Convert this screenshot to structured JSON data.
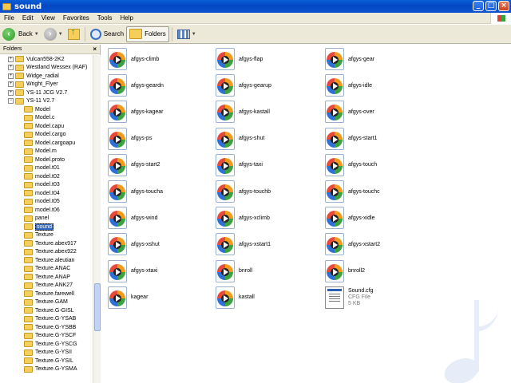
{
  "window": {
    "title": "sound",
    "buttons": [
      "_",
      "□",
      "×"
    ]
  },
  "menu": [
    "File",
    "Edit",
    "View",
    "Favorites",
    "Tools",
    "Help"
  ],
  "toolbar": {
    "back": "Back",
    "search": "Search",
    "folders": "Folders"
  },
  "folders_pane": {
    "title": "Folders",
    "close": "×",
    "tree": [
      {
        "label": "Vulcan558-2K2",
        "expander": "+"
      },
      {
        "label": "Westland Wessex (RAF)",
        "expander": "+"
      },
      {
        "label": "Widge_radial",
        "expander": "+"
      },
      {
        "label": "Wright_Flyer",
        "expander": "+"
      },
      {
        "label": "YS-11 JCG V2.7",
        "expander": "+"
      },
      {
        "label": "YS-11 V2.7",
        "expander": "−"
      },
      {
        "label": "Model"
      },
      {
        "label": "Model.c"
      },
      {
        "label": "Model.capu"
      },
      {
        "label": "Model.cargo"
      },
      {
        "label": "Model.cargoapu"
      },
      {
        "label": "Model.m"
      },
      {
        "label": "Model.proto"
      },
      {
        "label": "model.t01"
      },
      {
        "label": "model.t02"
      },
      {
        "label": "model.t03"
      },
      {
        "label": "model.t04"
      },
      {
        "label": "model.t05"
      },
      {
        "label": "model.t06"
      },
      {
        "label": "panel"
      },
      {
        "label": "sound",
        "selected": true
      },
      {
        "label": "Texture"
      },
      {
        "label": "Texture.abex917"
      },
      {
        "label": "Texture.abex922"
      },
      {
        "label": "Texture.aleutian"
      },
      {
        "label": "Texture.ANAC"
      },
      {
        "label": "Texture.ANAP"
      },
      {
        "label": "Texture.ANK27"
      },
      {
        "label": "Texture.farewell"
      },
      {
        "label": "Texture.GAM"
      },
      {
        "label": "Texture.G-GISL"
      },
      {
        "label": "Texture.G-YSAB"
      },
      {
        "label": "Texture.G-YSBB"
      },
      {
        "label": "Texture.G-YSCF"
      },
      {
        "label": "Texture.G-YSCG"
      },
      {
        "label": "Texture.G-YSII"
      },
      {
        "label": "Texture.G-YSIL"
      },
      {
        "label": "Texture.G-YSMA"
      }
    ]
  },
  "files": [
    {
      "name": "afgys-climb"
    },
    {
      "name": "afgys-flap"
    },
    {
      "name": "afgys-gear"
    },
    {
      "name": "afgys-geardn"
    },
    {
      "name": "afgys-gearup"
    },
    {
      "name": "afgys-idle"
    },
    {
      "name": "afgys-kagear"
    },
    {
      "name": "afgys-kastall"
    },
    {
      "name": "afgys-over"
    },
    {
      "name": "afgys-ps"
    },
    {
      "name": "afgys-shut"
    },
    {
      "name": "afgys-start1"
    },
    {
      "name": "afgys-start2"
    },
    {
      "name": "afgys-taxi"
    },
    {
      "name": "afgys-touch"
    },
    {
      "name": "afgys-toucha"
    },
    {
      "name": "afgys-touchb"
    },
    {
      "name": "afgys-touchc"
    },
    {
      "name": "afgys-wind"
    },
    {
      "name": "afgys-xclimb"
    },
    {
      "name": "afgys-xidle"
    },
    {
      "name": "afgys-xshut"
    },
    {
      "name": "afgys-xstart1"
    },
    {
      "name": "afgys-xstart2"
    },
    {
      "name": "afgys-xtaxi"
    },
    {
      "name": "bnroll"
    },
    {
      "name": "bnroll2"
    },
    {
      "name": "kagear"
    },
    {
      "name": "kastall"
    },
    {
      "name": "Sound.cfg",
      "type": "CFG File",
      "size": "5 KB",
      "kind": "cfg"
    }
  ]
}
